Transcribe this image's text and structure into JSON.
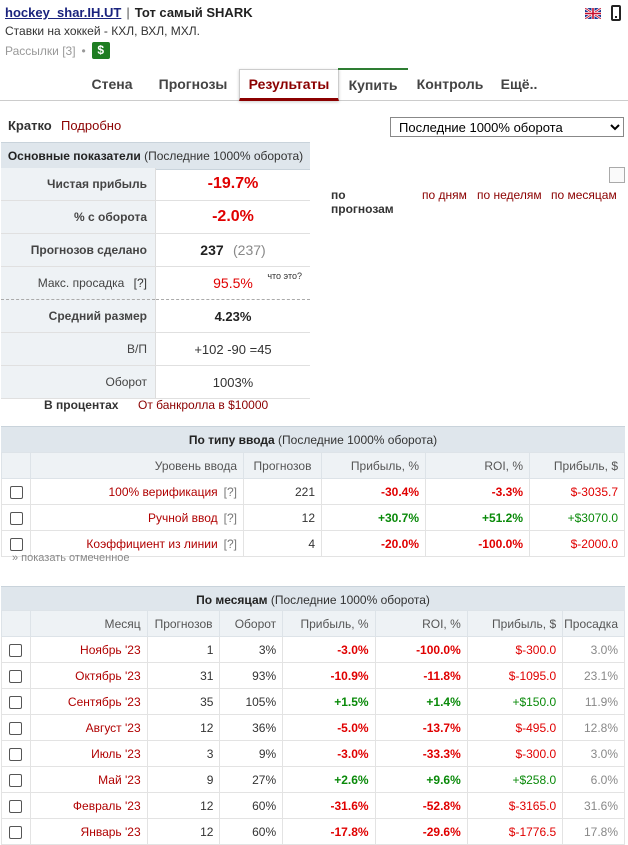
{
  "header": {
    "username": "hockey_shar.IH.UT",
    "separator": "|",
    "title": "Тот самый SHARK",
    "subtitle": "Ставки на хоккей - КХЛ, ВХЛ, МХЛ.",
    "mailings": "Рассылки [3]",
    "dot": "•",
    "dollar": "$"
  },
  "tabs": [
    {
      "label": "Стена"
    },
    {
      "label": "Прогнозы"
    },
    {
      "label": "Результаты"
    },
    {
      "label": "Купить"
    },
    {
      "label": "Контроль"
    },
    {
      "label": "Ещё.."
    }
  ],
  "view": {
    "brief": "Кратко",
    "detail": "Подробно"
  },
  "period_select": "Последние 1000% оборота",
  "main_stats": {
    "header_title": "Основные показатели",
    "header_period": "(Последние 1000% оборота)",
    "rows": [
      {
        "label": "Чистая прибыль",
        "value": "-19.7%"
      },
      {
        "label": "% с оборота",
        "value": "-2.0%"
      },
      {
        "label": "Прогнозов сделано",
        "value": "237",
        "extra": "(237)"
      },
      {
        "label": "Макс. просадка",
        "help": "[?]",
        "value": "95.5%",
        "extra": "что это?"
      },
      {
        "label": "Средний размер",
        "value": "4.23%"
      },
      {
        "label": "В/П",
        "value": "+102 -90 =45"
      },
      {
        "label": "Оборот",
        "value": "1003%"
      }
    ],
    "in_percent": "В процентах",
    "from_bank": "От банкролла в $10000"
  },
  "stat_links": {
    "label": "по прогнозам",
    "days": "по дням",
    "weeks": "по неделям",
    "months": "по месяцам"
  },
  "by_input": {
    "header_title": "По типу ввода",
    "header_period": "(Последние 1000% оборота)",
    "columns": [
      "Уровень ввода",
      "Прогнозов",
      "Прибыль, %",
      "ROI, %",
      "Прибыль, $"
    ],
    "rows": [
      {
        "name": "100% верификация",
        "help": "[?]",
        "count": "221",
        "profit_pct": "-30.4%",
        "roi": "-3.3%",
        "profit_usd": "$-3035.7"
      },
      {
        "name": "Ручной ввод",
        "help": "[?]",
        "count": "12",
        "profit_pct": "+30.7%",
        "roi": "+51.2%",
        "profit_usd": "+$3070.0"
      },
      {
        "name": "Коэффициент из линии",
        "help": "[?]",
        "count": "4",
        "profit_pct": "-20.0%",
        "roi": "-100.0%",
        "profit_usd": "$-2000.0"
      }
    ],
    "show_marked": "» показать отмеченное"
  },
  "by_month": {
    "header_title": "По месяцам",
    "header_period": "(Последние 1000% оборота)",
    "columns": [
      "Месяц",
      "Прогнозов",
      "Оборот",
      "Прибыль, %",
      "ROI, %",
      "Прибыль, $",
      "Просадка"
    ],
    "rows": [
      {
        "month": "Ноябрь '23",
        "count": "1",
        "turnover": "3%",
        "profit_pct": "-3.0%",
        "roi": "-100.0%",
        "profit_usd": "$-300.0",
        "drawdown": "3.0%"
      },
      {
        "month": "Октябрь '23",
        "count": "31",
        "turnover": "93%",
        "profit_pct": "-10.9%",
        "roi": "-11.8%",
        "profit_usd": "$-1095.0",
        "drawdown": "23.1%"
      },
      {
        "month": "Сентябрь '23",
        "count": "35",
        "turnover": "105%",
        "profit_pct": "+1.5%",
        "roi": "+1.4%",
        "profit_usd": "+$150.0",
        "drawdown": "11.9%"
      },
      {
        "month": "Август '23",
        "count": "12",
        "turnover": "36%",
        "profit_pct": "-5.0%",
        "roi": "-13.7%",
        "profit_usd": "$-495.0",
        "drawdown": "12.8%"
      },
      {
        "month": "Июль '23",
        "count": "3",
        "turnover": "9%",
        "profit_pct": "-3.0%",
        "roi": "-33.3%",
        "profit_usd": "$-300.0",
        "drawdown": "3.0%"
      },
      {
        "month": "Май '23",
        "count": "9",
        "turnover": "27%",
        "profit_pct": "+2.6%",
        "roi": "+9.6%",
        "profit_usd": "+$258.0",
        "drawdown": "6.0%"
      },
      {
        "month": "Февраль '23",
        "count": "12",
        "turnover": "60%",
        "profit_pct": "-31.6%",
        "roi": "-52.8%",
        "profit_usd": "$-3165.0",
        "drawdown": "31.6%"
      },
      {
        "month": "Январь '23",
        "count": "12",
        "turnover": "60%",
        "profit_pct": "-17.8%",
        "roi": "-29.6%",
        "profit_usd": "$-1776.5",
        "drawdown": "17.8%"
      }
    ]
  },
  "colors": {
    "negative": "#e00000",
    "positive": "#0a8a0a",
    "link": "#8b0000",
    "header_bg": "#dfe6ec",
    "buy_accent": "#2e7d32"
  }
}
